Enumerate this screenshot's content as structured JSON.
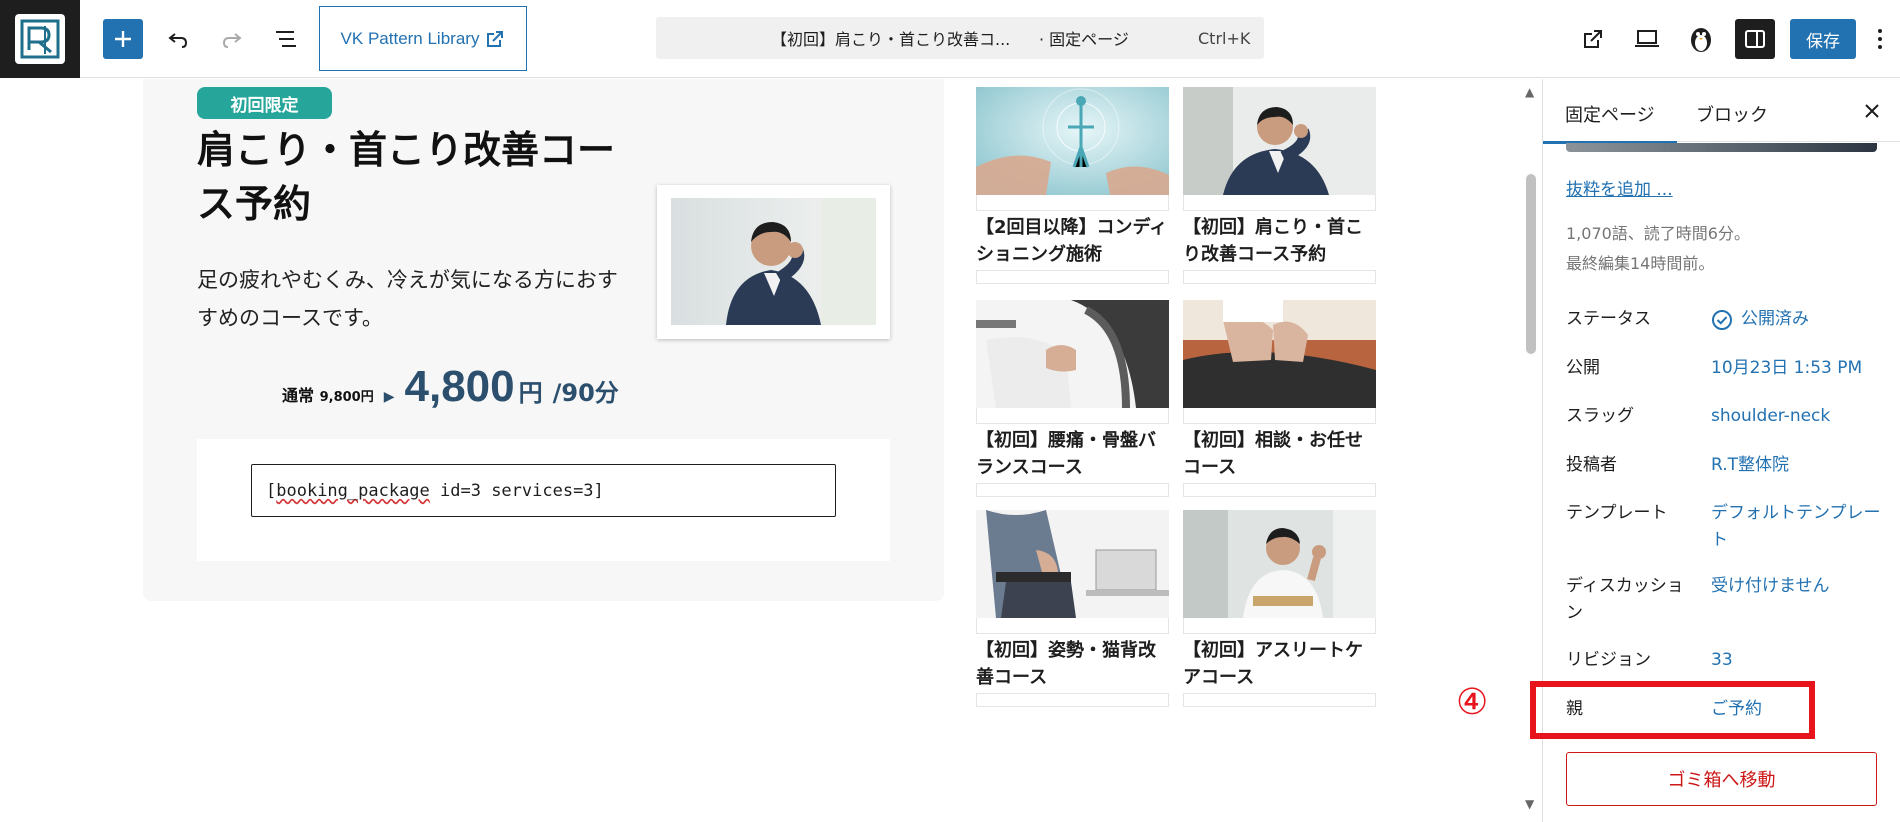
{
  "toolbar": {
    "vk_pattern_label": "VK Pattern Library",
    "command_title": "【初回】肩こり・首こり改善コ...",
    "command_type": "· 固定ページ",
    "command_shortcut": "Ctrl+K",
    "save_label": "保存",
    "accent": "#2271b1"
  },
  "main": {
    "badge": "初回限定",
    "title": "肩こり・首こり改善コース予約",
    "description": "足の疲れやむくみ、冷えが気になる方におすすめのコースです。",
    "price": {
      "normal_label": "通常",
      "normal_value": "9,800円",
      "sale_value": "4,800",
      "sale_unit": "円",
      "duration": "/90分"
    },
    "booking_shortcode": "[booking_package id=3 services=3]"
  },
  "courses": [
    {
      "title": "【2回目以降】コンディショニング施術"
    },
    {
      "title": "【初回】肩こり・首こり改善コース予約"
    },
    {
      "title": "【初回】腰痛・骨盤バランスコース"
    },
    {
      "title": "【初回】相談・お任せコース"
    },
    {
      "title": "【初回】姿勢・猫背改善コース"
    },
    {
      "title": "【初回】アスリートケアコース"
    }
  ],
  "sidebar": {
    "tab_page": "固定ページ",
    "tab_block": "ブロック",
    "excerpt_link": "抜粋を追加 ...",
    "meta_words": "1,070語、読了時間6分。",
    "meta_edited": "最終編集14時間前。",
    "rows": [
      {
        "label": "ステータス",
        "value": "公開済み"
      },
      {
        "label": "公開",
        "value": "10月23日 1:53 PM"
      },
      {
        "label": "スラッグ",
        "value": "shoulder-neck"
      },
      {
        "label": "投稿者",
        "value": "R.T整体院"
      },
      {
        "label": "テンプレート",
        "value": "デフォルトテンプレート"
      },
      {
        "label": "ディスカッション",
        "value": "受け付けません"
      },
      {
        "label": "リビジョン",
        "value": "33"
      },
      {
        "label": "親",
        "value": "ご予約"
      }
    ],
    "trash_label": "ゴミ箱へ移動"
  },
  "annotation": {
    "callout": "④",
    "color": "#e8141c"
  }
}
